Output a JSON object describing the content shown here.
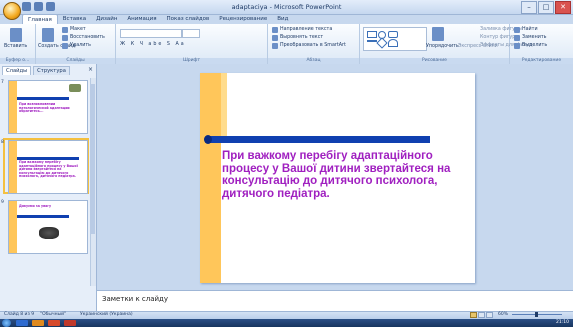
{
  "window": {
    "title": "adaptaciya - Microsoft PowerPoint",
    "controls": [
      "–",
      "□",
      "✕"
    ]
  },
  "tabs": [
    "Главная",
    "Вставка",
    "Дизайн",
    "Анимация",
    "Показ слайдов",
    "Рецензирование",
    "Вид"
  ],
  "ribbon": {
    "groups": [
      {
        "label": "Буфер о...",
        "buttons": [
          "Вставить"
        ]
      },
      {
        "label": "Слайды",
        "buttons": [
          "Создать слайд",
          "Макет",
          "Восстановить",
          "Удалить"
        ]
      },
      {
        "label": "Шрифт",
        "buttons": [
          "Ж К Ч abe S Aa"
        ]
      },
      {
        "label": "Абзац",
        "buttons": [
          "Направление текста",
          "Выровнять текст",
          "Преобразовать в SmartArt"
        ]
      },
      {
        "label": "Рисование",
        "buttons": [
          "Упорядочить",
          "Экспресс-стили",
          "Заливка фигуры",
          "Контур фигуры",
          "Эффекты для фигур"
        ]
      },
      {
        "label": "Редактирование",
        "buttons": [
          "Найти",
          "Заменить",
          "Выделить"
        ]
      }
    ]
  },
  "panel": {
    "tabs": [
      "Слайды",
      "Структура"
    ],
    "close": "×",
    "thumbnails": [
      {
        "num": "7",
        "text": "При возникновении патологической адаптации обратитесь..."
      },
      {
        "num": "8",
        "text": "При важкому перебігу адаптаційного процесу у Вашої дитини звертайтеся на консультацію до дитячого психолога, дитячого педіатра."
      },
      {
        "num": "9",
        "text": "Дякуємо за увагу"
      }
    ]
  },
  "slide": {
    "text": "При важкому перебігу адаптаційного процесу у Вашої дитини звертайтеся на консультацію до дитячого психолога, дитячого педіатра."
  },
  "notes": {
    "placeholder": "Заметки к слайду"
  },
  "status": {
    "slide": "Слайд 8 из 9",
    "theme": "\"Обычный\"",
    "lang": "Украинский (Украина)",
    "zoom": "60%"
  },
  "taskbar": {
    "clock": "21:10"
  }
}
